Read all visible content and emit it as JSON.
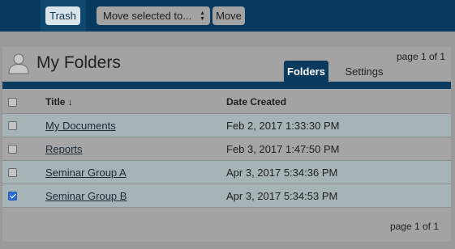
{
  "toolbar": {
    "trash_label": "Trash",
    "move_select_value": "Move selected to...",
    "move_label": "Move"
  },
  "panel": {
    "title": "My Folders",
    "page_info_top": "page 1 of 1",
    "page_info_bottom": "page 1 of 1",
    "tabs": [
      {
        "label": "Folders",
        "active": true
      },
      {
        "label": "Settings",
        "active": false
      }
    ]
  },
  "table": {
    "headers": {
      "title": "Title ↓",
      "date": "Date Created"
    },
    "rows": [
      {
        "title": "My Documents",
        "date": "Feb 2, 2017 1:33:30 PM",
        "checked": false
      },
      {
        "title": "Reports",
        "date": "Feb 3, 2017 1:47:50 PM",
        "checked": false
      },
      {
        "title": "Seminar Group A",
        "date": "Apr 3, 2017 5:34:36 PM",
        "checked": false
      },
      {
        "title": "Seminar Group B",
        "date": "Apr 3, 2017 5:34:53 PM",
        "checked": true
      }
    ]
  },
  "colors": {
    "topbar": "#083a5f",
    "accent": "#0b3a5f",
    "checkbox_checked": "#2a6fd6"
  },
  "icons": {
    "user": "user-icon",
    "select_arrows": "updown-arrows-icon"
  }
}
